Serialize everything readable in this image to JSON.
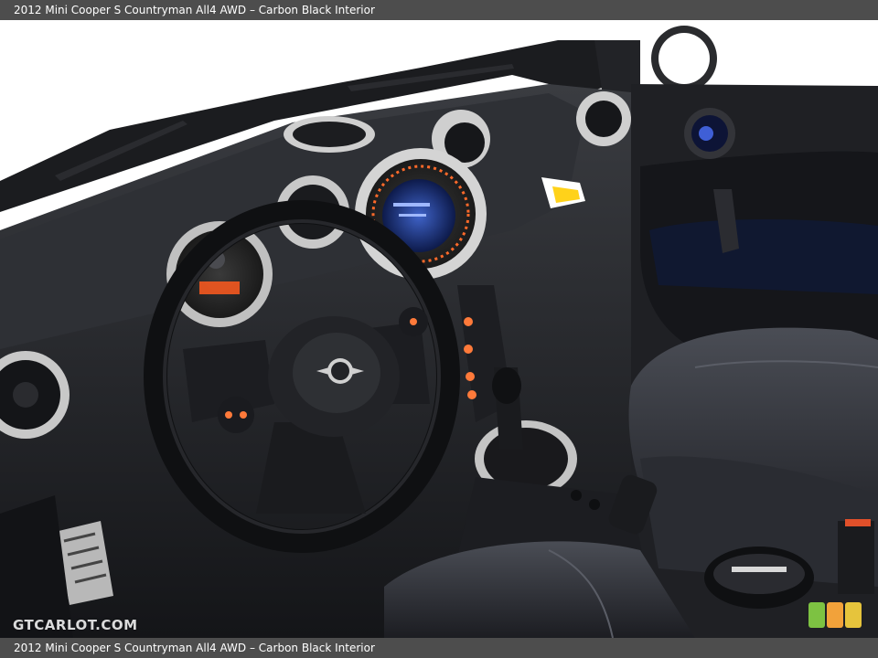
{
  "caption": {
    "top": "2012 Mini Cooper S Countryman All4 AWD – Carbon Black Interior",
    "bottom": "2012 Mini Cooper S Countryman All4 AWD – Carbon Black Interior"
  },
  "watermark": "GTCARLOT.COM",
  "rating_colors": [
    "#7dc242",
    "#f2a23a",
    "#e6c43c"
  ]
}
